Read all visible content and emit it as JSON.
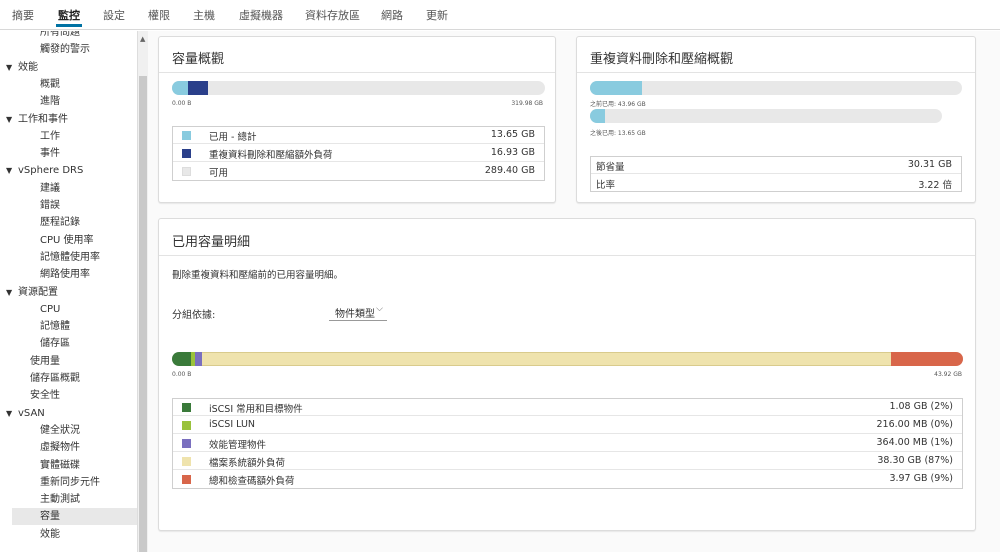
{
  "tabs": [
    {
      "label": "摘要",
      "active": false
    },
    {
      "label": "監控",
      "active": true
    },
    {
      "label": "設定",
      "active": false
    },
    {
      "label": "權限",
      "active": false
    },
    {
      "label": "主機",
      "active": false
    },
    {
      "label": "虛擬機器",
      "active": false
    },
    {
      "label": "資料存放區",
      "active": false
    },
    {
      "label": "網路",
      "active": false
    },
    {
      "label": "更新",
      "active": false
    }
  ],
  "sidebar": {
    "items": [
      {
        "label": "所有問題",
        "level": "level1"
      },
      {
        "label": "觸發的警示",
        "level": "level1"
      },
      {
        "label": "效能",
        "level": "level0",
        "caret": "▼"
      },
      {
        "label": "概觀",
        "level": "level1"
      },
      {
        "label": "進階",
        "level": "level1"
      },
      {
        "label": "工作和事件",
        "level": "level0",
        "caret": "▼"
      },
      {
        "label": "工作",
        "level": "level1"
      },
      {
        "label": "事件",
        "level": "level1"
      },
      {
        "label": "vSphere DRS",
        "level": "level0",
        "caret": "▼"
      },
      {
        "label": "建議",
        "level": "level1"
      },
      {
        "label": "錯誤",
        "level": "level1"
      },
      {
        "label": "歷程記錄",
        "level": "level1"
      },
      {
        "label": "CPU 使用率",
        "level": "level1"
      },
      {
        "label": "記憶體使用率",
        "level": "level1"
      },
      {
        "label": "網路使用率",
        "level": "level1"
      },
      {
        "label": "資源配置",
        "level": "level0",
        "caret": "▼"
      },
      {
        "label": "CPU",
        "level": "level1"
      },
      {
        "label": "記憶體",
        "level": "level1"
      },
      {
        "label": "儲存區",
        "level": "level1"
      },
      {
        "label": "使用量",
        "level": "leaf0"
      },
      {
        "label": "儲存區概觀",
        "level": "leaf0"
      },
      {
        "label": "安全性",
        "level": "leaf0"
      },
      {
        "label": "vSAN",
        "level": "level0",
        "caret": "▼"
      },
      {
        "label": "健全狀況",
        "level": "level1"
      },
      {
        "label": "虛擬物件",
        "level": "level1"
      },
      {
        "label": "實體磁碟",
        "level": "level1"
      },
      {
        "label": "重新同步元件",
        "level": "level1"
      },
      {
        "label": "主動測試",
        "level": "level1"
      },
      {
        "label": "容量",
        "level": "level1",
        "selected": true
      },
      {
        "label": "效能",
        "level": "level1"
      }
    ]
  },
  "capacity_overview": {
    "title": "容量概觀",
    "bar_min": "0.00 B",
    "bar_max": "319.98 GB",
    "used_fraction": 0.0427,
    "overhead_fraction": 0.0529,
    "legend": [
      {
        "name": "已用 - 總計",
        "value": "13.65 GB",
        "color": "#89cbdf"
      },
      {
        "name": "重複資料刪除和壓縮額外負荷",
        "value": "16.93 GB",
        "color": "#2a3f8a"
      },
      {
        "name": "可用",
        "value": "289.40 GB",
        "color": "#e8e8e8"
      }
    ]
  },
  "dedup_overview": {
    "title": "重複資料刪除和壓縮概觀",
    "before_label": "之前已用: 43.96 GB",
    "before_fraction": 0.14,
    "after_label": "之後已用: 13.65 GB",
    "after_fraction": 0.044,
    "rows": [
      {
        "name": "節省量",
        "value": "30.31 GB"
      },
      {
        "name": "比率",
        "value": "3.22 倍"
      }
    ]
  },
  "breakdown": {
    "title": "已用容量明細",
    "description": "刪除重複資料和壓縮前的已用容量明細。",
    "group_label": "分組依據:",
    "group_value": "物件類型",
    "bar_min": "0.00 B",
    "bar_max": "43.92 GB",
    "legend": [
      {
        "name": "iSCSI 常用和目標物件",
        "value": "1.08 GB (2%)",
        "color": "#3a7a3a",
        "fraction": 0.0246
      },
      {
        "name": "iSCSI LUN",
        "value": "216.00 MB (0%)",
        "color": "#9ac23c",
        "fraction": 0.0048
      },
      {
        "name": "效能管理物件",
        "value": "364.00 MB (1%)",
        "color": "#7a6fbf",
        "fraction": 0.0081
      },
      {
        "name": "檔案系統額外負荷",
        "value": "38.30 GB (87%)",
        "color": "#efe3ad",
        "fraction": 0.872
      },
      {
        "name": "總和檢查碼額外負荷",
        "value": "3.97 GB (9%)",
        "color": "#d8664a",
        "fraction": 0.0904
      }
    ]
  }
}
